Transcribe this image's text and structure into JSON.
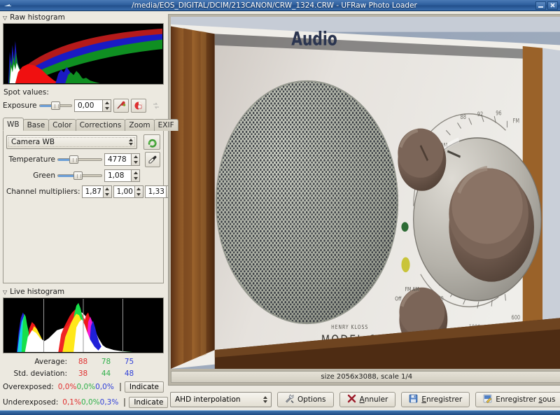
{
  "window": {
    "title": "/media/EOS_DIGITAL/DCIM/213CANON/CRW_1324.CRW - UFRaw Photo Loader",
    "minimize_label": "_",
    "close_label": "✕"
  },
  "raw_histogram": {
    "expander_label": "Raw histogram",
    "triangle": "▽"
  },
  "spot": {
    "label": "Spot values:"
  },
  "exposure": {
    "label": "Exposure",
    "value": "0,00",
    "slider_percent": 42,
    "icons": [
      "clip-highlights-icon",
      "auto-exposure-icon",
      "reset-exposure-icon"
    ]
  },
  "tabs": [
    {
      "label": "WB",
      "active": true
    },
    {
      "label": "Base",
      "active": false
    },
    {
      "label": "Color",
      "active": false
    },
    {
      "label": "Corrections",
      "active": false
    },
    {
      "label": "Zoom",
      "active": false
    },
    {
      "label": "EXIF",
      "active": false
    }
  ],
  "wb": {
    "preset": "Camera WB",
    "reset_icon": "wb-reset-icon",
    "temperature": {
      "label": "Temperature",
      "value": "4778",
      "slider_percent": 27
    },
    "green": {
      "label": "Green",
      "value": "1,08",
      "slider_percent": 38
    },
    "eyedropper_icon": "eyedropper-icon",
    "multipliers": {
      "label": "Channel multipliers:",
      "values": [
        "1,87",
        "1,00",
        "1,33"
      ]
    }
  },
  "live_histogram": {
    "expander_label": "Live histogram",
    "triangle": "▽"
  },
  "stats": {
    "rows": [
      {
        "key": "Average:",
        "r": "88",
        "g": "78",
        "b": "75",
        "has_check": false,
        "button": null
      },
      {
        "key": "Std. deviation:",
        "r": "38",
        "g": "44",
        "b": "48",
        "has_check": false,
        "button": null
      },
      {
        "key": "Overexposed:",
        "r": "0,0%",
        "g": "0,0%",
        "b": "0,0%",
        "has_check": true,
        "button": "Indicate"
      },
      {
        "key": "Underexposed:",
        "r": "0,1%",
        "g": "0,0%",
        "b": "0,3%",
        "has_check": true,
        "button": "Indicate"
      }
    ]
  },
  "preview": {
    "size_text": "size 2056x3088, scale 1/4",
    "radio_brand": "Audio",
    "radio_model": "MODEL ONE",
    "radio_designer": "HENRY KLOSS"
  },
  "actions": {
    "interpolation": "AHD interpolation",
    "options": "Options",
    "cancel": "Annuler",
    "save": "Enregistrer",
    "save_as": "Enregistrer sous"
  },
  "colors": {
    "accent": "#6b9ed6",
    "title_bar": "#2e5f9e",
    "red": "#e03030",
    "green": "#2faf4a",
    "blue": "#3040d8",
    "panel_bg": "#ece9e0"
  }
}
